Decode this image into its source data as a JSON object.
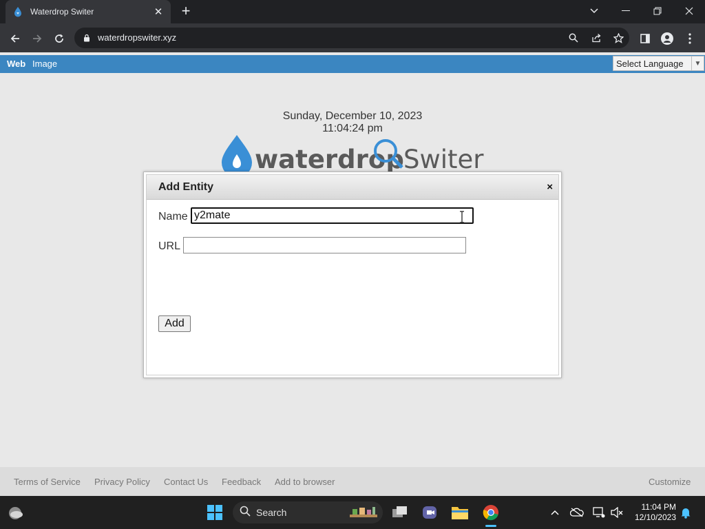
{
  "browser": {
    "tab_title": "Waterdrop Switer",
    "url": "waterdropswiter.xyz"
  },
  "topbar": {
    "links": [
      "Web",
      "Image"
    ],
    "language_select": "Select Language"
  },
  "page": {
    "date": "Sunday, December 10, 2023",
    "time": "11:04:24 pm",
    "logo_text_1": "waterdrop",
    "logo_text_2": "Switer"
  },
  "modal": {
    "title": "Add Entity",
    "close_label": "×",
    "name_label": "Name",
    "name_value": "y2mate",
    "url_label": "URL",
    "url_value": "",
    "add_label": "Add"
  },
  "footer": {
    "links": [
      "Terms of Service",
      "Privacy Policy",
      "Contact Us",
      "Feedback",
      "Add to browser"
    ],
    "customize": "Customize"
  },
  "taskbar": {
    "search_label": "Search",
    "time": "11:04 PM",
    "date": "12/10/2023"
  },
  "colors": {
    "topbar_blue": "#3b86c1",
    "logo_gray": "#5a5a5a",
    "logo_blue": "#3a8fd6"
  }
}
